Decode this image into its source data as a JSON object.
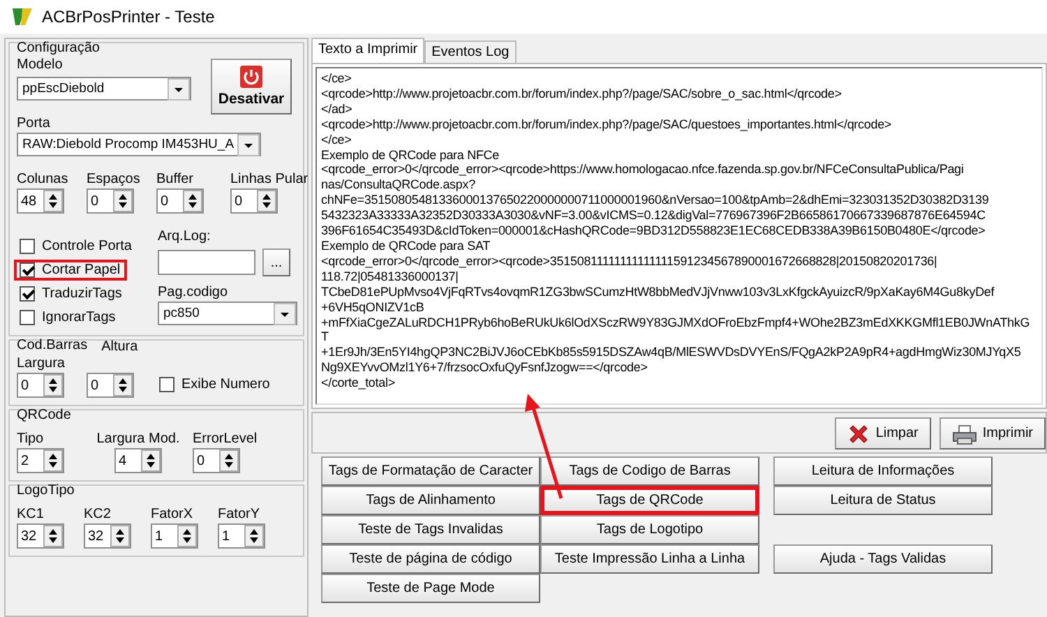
{
  "window": {
    "title": "ACBrPosPrinter - Teste"
  },
  "config": {
    "legend": "Configuração",
    "modelo": {
      "label": "Modelo",
      "value": "ppEscDiebold"
    },
    "button": {
      "label": "Desativar"
    },
    "porta": {
      "label": "Porta",
      "value": "RAW:Diebold Procomp IM453HU_A"
    },
    "spins": [
      {
        "label": "Colunas",
        "value": "48"
      },
      {
        "label": "Espaços",
        "value": "0"
      },
      {
        "label": "Buffer",
        "value": "0"
      },
      {
        "label": "Linhas Pular",
        "value": "0"
      }
    ],
    "checks": [
      {
        "label": "Controle Porta",
        "checked": false,
        "highlighted": false
      },
      {
        "label": "Cortar Papel",
        "checked": true,
        "highlighted": true
      },
      {
        "label": "TraduzirTags",
        "checked": true,
        "highlighted": false
      },
      {
        "label": "IgnorarTags",
        "checked": false,
        "highlighted": false
      }
    ],
    "arqlog": {
      "label": "Arq.Log:",
      "button": "..."
    },
    "pagcodigo": {
      "label": "Pag.codigo",
      "value": "pc850"
    }
  },
  "barcode": {
    "legend": "Cod.Barras",
    "header_label": "Altura",
    "spins": [
      {
        "label": "Largura",
        "value": "0"
      },
      {
        "value": "0"
      }
    ],
    "check": {
      "label": "Exibe Numero",
      "checked": false
    }
  },
  "qrcode": {
    "legend": "QRCode",
    "spins": [
      {
        "label": "Tipo",
        "value": "2"
      },
      {
        "label": "Largura Mod.",
        "value": "4"
      },
      {
        "label": "ErrorLevel",
        "value": "0"
      }
    ]
  },
  "logo": {
    "legend": "LogoTipo",
    "spins": [
      {
        "label": "KC1",
        "value": "32"
      },
      {
        "label": "KC2",
        "value": "32"
      },
      {
        "label": "FatorX",
        "value": "1"
      },
      {
        "label": "FatorY",
        "value": "1"
      }
    ]
  },
  "tabs": [
    {
      "label": "Texto a Imprimir",
      "selected": true
    },
    {
      "label": "Eventos Log",
      "selected": false
    }
  ],
  "text_lines": [
    "</ce>",
    "<qrcode>http://www.projetoacbr.com.br/forum/index.php?/page/SAC/sobre_o_sac.html</qrcode>",
    "</ad>",
    "<qrcode>http://www.projetoacbr.com.br/forum/index.php?/page/SAC/questoes_importantes.html</qrcode>",
    "</ce>",
    "Exemplo de QRCode para NFCe",
    "<qrcode_error>0</qrcode_error><qrcode>https://www.homologacao.nfce.fazenda.sp.gov.br/NFCeConsultaPublica/Pagi",
    "nas/ConsultaQRCode.aspx?",
    "chNFe=35150805481336000137650220000000711000001960&nVersao=100&tpAmb=2&dhEmi=323031352D30382D3139",
    "5432323A33333A32352D30333A3030&vNF=3.00&vICMS=0.12&digVal=776967396F2B66586170667339687876E64594C",
    "396F61654C35493D&cIdToken=000001&cHashQRCode=9BD312D558823E1EC68CEDB338A39B6150B0480E</qrcode>",
    "Exemplo de QRCode para SAT",
    "<qrcode_error>0</qrcode_error><qrcode>35150811111111111111591234567890001672668828|20150820201736|",
    "118.72|05481336000137|",
    "TCbeD81ePUpMvso4VjFqRTvs4ovqmR1ZG3bwSCumzHtW8bbMedVJjVnww103v3LxKfgckAyuizcR/9pXaKay6M4Gu8kyDef",
    "+6VH5qONIZV1cB",
    "+mFfXiaCgeZALuRDCH1PRyb6hoBeRUkUk6lOdXSczRW9Y83GJMXdOFroEbzFmpf4+WOhe2BZ3mEdXKKGMfl1EB0JWnAThkG",
    "T",
    "+1Er9Jh/3En5YI4hgQP3NC2BiJVJ6oCEbKb85s5915DSZAw4qB/MlESWVDsDVYEnS/FQgA2kP2A9pR4+agdHmgWiz30MJYqX5",
    "Ng9XEYvvOMzl1Y6+7/frzsocOxfuQyFsnfJzogw==</qrcode>",
    "</corte_total>"
  ],
  "actions": [
    {
      "label": "Limpar",
      "kind": "clear"
    },
    {
      "label": "Imprimir",
      "kind": "print"
    }
  ],
  "button_columns": [
    [
      {
        "kind": "button",
        "label": "Tags de Formatação de Caracter",
        "highlighted": false
      },
      {
        "kind": "button",
        "label": "Tags de Alinhamento",
        "highlighted": false
      },
      {
        "kind": "button",
        "label": "Teste de Tags Invalidas",
        "highlighted": false
      },
      {
        "kind": "button",
        "label": "Teste de página de código",
        "highlighted": false
      },
      {
        "kind": "button",
        "label": "Teste de Page Mode",
        "highlighted": false
      }
    ],
    [
      {
        "kind": "button",
        "label": "Tags de Codigo de Barras",
        "highlighted": false
      },
      {
        "kind": "button",
        "label": "Tags de QRCode",
        "highlighted": true
      },
      {
        "kind": "button",
        "label": "Tags de Logotipo",
        "highlighted": false
      },
      {
        "kind": "button",
        "label": "Teste Impressão Linha a Linha",
        "highlighted": false
      }
    ],
    [
      {
        "kind": "button",
        "label": "Leitura de Informações",
        "highlighted": false
      },
      {
        "kind": "button",
        "label": "Leitura de Status",
        "highlighted": false
      },
      {
        "kind": "spacer"
      },
      {
        "kind": "button",
        "label": "Ajuda - Tags Validas",
        "highlighted": false
      }
    ]
  ],
  "annotation": {
    "kind": "arrow"
  }
}
